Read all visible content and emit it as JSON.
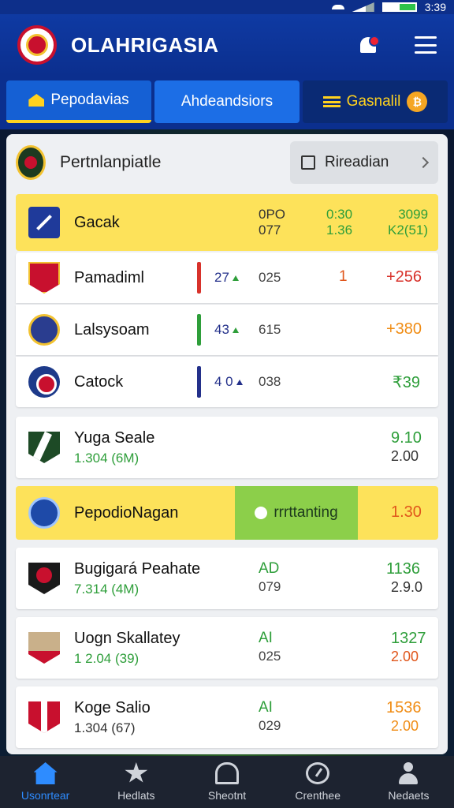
{
  "status_bar": {
    "time": "3:39"
  },
  "header": {
    "title": "OLAHRIGASIA"
  },
  "tabs": [
    {
      "label": "Pepodavias",
      "icon": "home-icon"
    },
    {
      "label": "Ahdeandsiors"
    },
    {
      "label": "Gasnalil",
      "icon": "stack-icon",
      "badge": "₿"
    }
  ],
  "panel": {
    "title": "Pertnlanpiatle",
    "select_label": "Rireadian"
  },
  "rows": [
    {
      "team": "Gacak",
      "c1": "0PO\n077",
      "c2": "0:30\n1.36",
      "c3": "3099\nK2(51)"
    },
    {
      "team": "Pamadiml",
      "score": "27",
      "mid": "025",
      "one": "1",
      "odds": "+256"
    },
    {
      "team": "Lalsysoam",
      "score": "43",
      "mid": "615",
      "odds": "+380"
    },
    {
      "team": "Catock",
      "score": "4 0",
      "mid": "038",
      "odds": "₹39"
    },
    {
      "team": "Yuga Seale",
      "sub": "1.304 (6M)",
      "top": "9.10",
      "bottom": "2.00"
    },
    {
      "team": "PepodioNagan",
      "highlight": "rrrttanting",
      "odds": "1.30"
    },
    {
      "team": "Bugigará Peahate",
      "sub": "7.314 (4M)",
      "mid_top": "AD",
      "mid_bottom": "079",
      "top": "1136",
      "bottom": "2.9.0"
    },
    {
      "team": "Uogn Skallatey",
      "sub": "1 2.04 (39)",
      "mid_top": "AI",
      "mid_bottom": "025",
      "top": "1327",
      "bottom": "2.00"
    },
    {
      "team": "Koge Salio",
      "sub": "1.304 (67)",
      "mid_top": "AI",
      "mid_bottom": "029",
      "top": "1536",
      "bottom": "2.00"
    }
  ],
  "bottom_nav": [
    {
      "label": "Usonrtear",
      "icon": "home-icon"
    },
    {
      "label": "Hedlats",
      "icon": "star-icon"
    },
    {
      "label": "Sheotnt",
      "icon": "stadium-icon"
    },
    {
      "label": "Crenthee",
      "icon": "gauge-icon"
    },
    {
      "label": "Nedaets",
      "icon": "user-icon"
    }
  ],
  "colors": {
    "primary": "#0f3aa3",
    "accent": "#ffd21f",
    "green": "#2e9e3a",
    "red": "#d8322b",
    "orange": "#f08c14"
  }
}
